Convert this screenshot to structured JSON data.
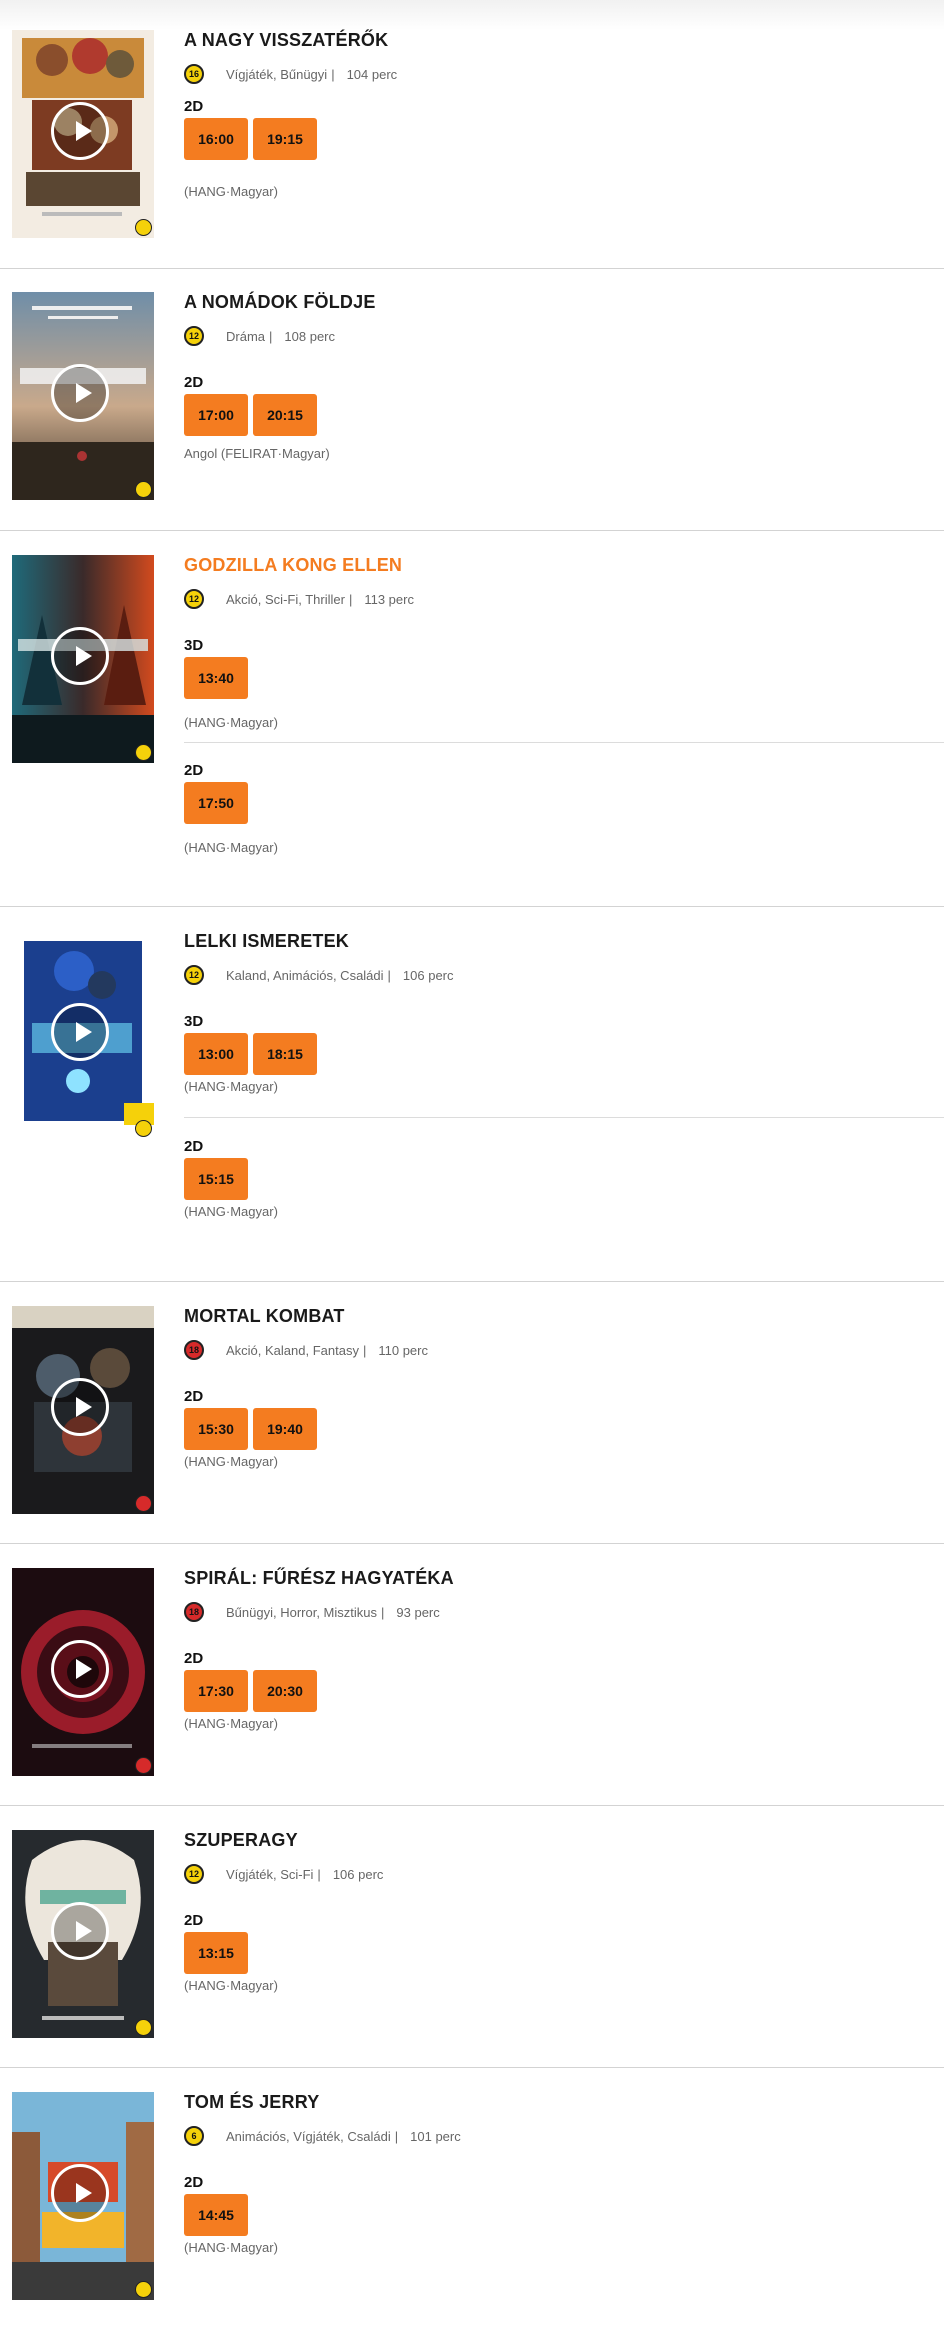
{
  "colors": {
    "accent": "#f47c20",
    "rating_yellow": "#f5d10a",
    "rating_red": "#d62a2a"
  },
  "movies": [
    {
      "title": "A NAGY VISSZATÉRŐK",
      "rating": "16",
      "genres": "Vígjáték, Bűnügyi",
      "separator": "|",
      "duration": "104 perc",
      "shows": [
        {
          "format": "2D",
          "times": [
            "16:00",
            "19:15"
          ],
          "language": "(HANG·Magyar)"
        }
      ]
    },
    {
      "title": "A NOMÁDOK FÖLDJE",
      "rating": "12",
      "genres": "Dráma",
      "separator": "|",
      "duration": "108 perc",
      "shows": [
        {
          "format": "2D",
          "times": [
            "17:00",
            "20:15"
          ],
          "language": "Angol (FELIRAT·Magyar)"
        }
      ]
    },
    {
      "title": "GODZILLA KONG ELLEN",
      "rating": "12",
      "genres": "Akció, Sci-Fi, Thriller",
      "separator": "|",
      "duration": "113 perc",
      "shows": [
        {
          "format": "3D",
          "times": [
            "13:40"
          ],
          "language": "(HANG·Magyar)"
        },
        {
          "format": "2D",
          "times": [
            "17:50"
          ],
          "language": "(HANG·Magyar)"
        }
      ]
    },
    {
      "title": "LELKI ISMERETEK",
      "rating": "12",
      "genres": "Kaland, Animációs, Családi",
      "separator": "|",
      "duration": "106 perc",
      "shows": [
        {
          "format": "3D",
          "times": [
            "13:00",
            "18:15"
          ],
          "language": "(HANG·Magyar)"
        },
        {
          "format": "2D",
          "times": [
            "15:15"
          ],
          "language": "(HANG·Magyar)"
        }
      ]
    },
    {
      "title": "MORTAL KOMBAT",
      "rating": "18",
      "genres": "Akció, Kaland, Fantasy",
      "separator": "|",
      "duration": "110 perc",
      "shows": [
        {
          "format": "2D",
          "times": [
            "15:30",
            "19:40"
          ],
          "language": "(HANG·Magyar)"
        }
      ]
    },
    {
      "title": "SPIRÁL: FŰRÉSZ HAGYATÉKA",
      "rating": "18",
      "genres": "Bűnügyi, Horror, Misztikus",
      "separator": "|",
      "duration": "93 perc",
      "shows": [
        {
          "format": "2D",
          "times": [
            "17:30",
            "20:30"
          ],
          "language": "(HANG·Magyar)"
        }
      ]
    },
    {
      "title": "SZUPERAGY",
      "rating": "12",
      "genres": "Vígjáték, Sci-Fi",
      "separator": "|",
      "duration": "106 perc",
      "shows": [
        {
          "format": "2D",
          "times": [
            "13:15"
          ],
          "language": "(HANG·Magyar)"
        }
      ]
    },
    {
      "title": "TOM ÉS JERRY",
      "rating": "6",
      "genres": "Animációs, Vígjáték, Családi",
      "separator": "|",
      "duration": "101 perc",
      "shows": [
        {
          "format": "2D",
          "times": [
            "14:45"
          ],
          "language": "(HANG·Magyar)"
        }
      ]
    }
  ]
}
